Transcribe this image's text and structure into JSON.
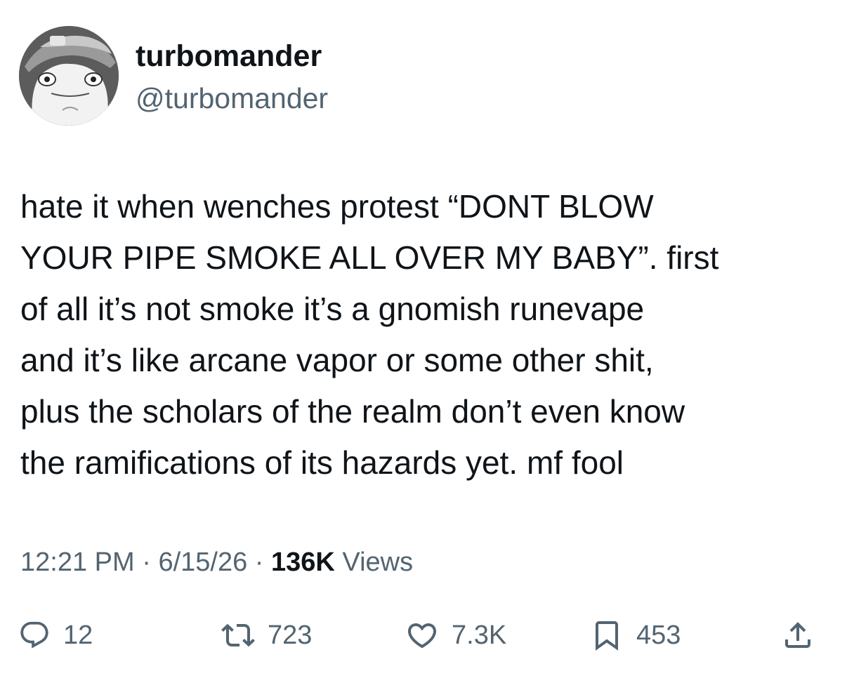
{
  "author": {
    "display_name": "turbomander",
    "handle": "@turbomander",
    "avatar_icon": "frog-avatar"
  },
  "tweet": {
    "lines": [
      "hate it when wenches protest “DONT BLOW",
      "YOUR PIPE SMOKE ALL OVER MY BABY”. first",
      "of all it’s not smoke it’s a gnomish runevape",
      "and it’s like arcane vapor or some other shit,",
      "plus the scholars of the realm don’t even know",
      "the ramifications of its hazards yet. mf fool"
    ]
  },
  "meta": {
    "time": "12:21 PM",
    "separator": "·",
    "date": "6/15/26",
    "views_count": "136K",
    "views_label": "Views"
  },
  "actions": {
    "replies": "12",
    "reposts": "723",
    "likes": "7.3K",
    "bookmarks": "453"
  },
  "colors": {
    "text_primary": "#0f1419",
    "text_secondary": "#536471",
    "background": "#ffffff"
  }
}
